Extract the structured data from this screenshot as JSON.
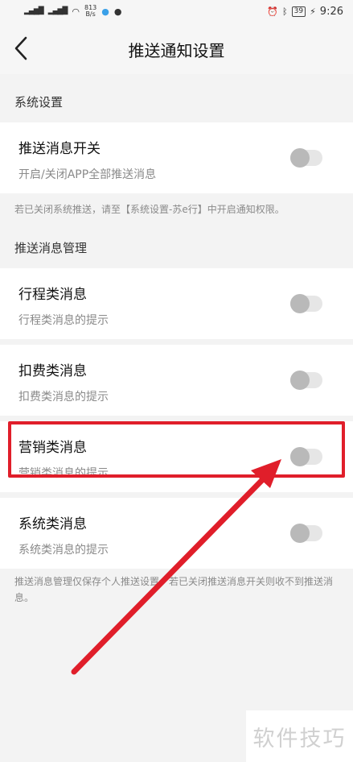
{
  "status_bar": {
    "net_speed_value": "813",
    "net_speed_unit": "B/s",
    "battery": "39",
    "time": "9:26"
  },
  "nav": {
    "title": "推送通知设置"
  },
  "system_section": {
    "header": "系统设置",
    "push_switch": {
      "title": "推送消息开关",
      "subtitle": "开启/关闭APP全部推送消息",
      "enabled": false
    },
    "note": "若已关闭系统推送，请至【系统设置-苏e行】中开启通知权限。"
  },
  "manage_section": {
    "header": "推送消息管理",
    "items": [
      {
        "title": "行程类消息",
        "subtitle": "行程类消息的提示",
        "enabled": false
      },
      {
        "title": "扣费类消息",
        "subtitle": "扣费类消息的提示",
        "enabled": false
      },
      {
        "title": "营销类消息",
        "subtitle": "营销类消息的提示",
        "enabled": false
      },
      {
        "title": "系统类消息",
        "subtitle": "系统类消息的提示",
        "enabled": false
      }
    ],
    "note": "推送消息管理仅保存个人推送设置，若已关闭推送消息开关则收不到推送消息。"
  },
  "annotation": {
    "color": "#e01e2a"
  },
  "watermark": {
    "text": "软件技巧"
  }
}
